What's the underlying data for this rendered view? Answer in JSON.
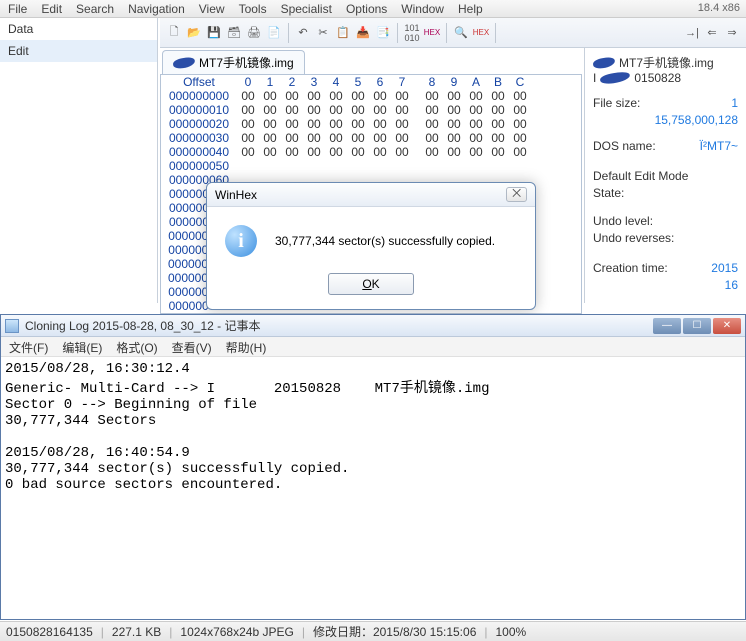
{
  "version": "18.4 x86",
  "menu": [
    "File",
    "Edit",
    "Search",
    "Navigation",
    "View",
    "Tools",
    "Specialist",
    "Options",
    "Window",
    "Help"
  ],
  "left": {
    "items": [
      "Data",
      "Edit"
    ]
  },
  "file_tab": "MT7手机镜像.img",
  "hex": {
    "offset_hdr": "Offset",
    "cols": [
      "0",
      "1",
      "2",
      "3",
      "4",
      "5",
      "6",
      "7",
      "8",
      "9",
      "A",
      "B",
      "C"
    ],
    "rows": [
      {
        "o": "000000000",
        "v": [
          "00",
          "00",
          "00",
          "00",
          "00",
          "00",
          "00",
          "00",
          "00",
          "00",
          "00",
          "00",
          "00"
        ]
      },
      {
        "o": "000000010",
        "v": [
          "00",
          "00",
          "00",
          "00",
          "00",
          "00",
          "00",
          "00",
          "00",
          "00",
          "00",
          "00",
          "00"
        ]
      },
      {
        "o": "000000020",
        "v": [
          "00",
          "00",
          "00",
          "00",
          "00",
          "00",
          "00",
          "00",
          "00",
          "00",
          "00",
          "00",
          "00"
        ]
      },
      {
        "o": "000000030",
        "v": [
          "00",
          "00",
          "00",
          "00",
          "00",
          "00",
          "00",
          "00",
          "00",
          "00",
          "00",
          "00",
          "00"
        ]
      },
      {
        "o": "000000040",
        "v": [
          "00",
          "00",
          "00",
          "00",
          "00",
          "00",
          "00",
          "00",
          "00",
          "00",
          "00",
          "00",
          "00"
        ]
      },
      {
        "o": "000000050",
        "v": [
          "",
          "",
          "",
          "",
          "",
          "",
          "",
          "",
          "",
          "",
          "",
          "",
          ""
        ]
      },
      {
        "o": "000000060",
        "v": [
          "",
          "",
          "",
          "",
          "",
          "",
          "",
          "",
          "",
          "",
          "",
          "",
          ""
        ]
      },
      {
        "o": "000000070",
        "v": [
          "",
          "",
          "",
          "",
          "",
          "",
          "",
          "",
          "",
          "",
          "",
          "",
          ""
        ]
      },
      {
        "o": "000000080",
        "v": [
          "",
          "",
          "",
          "",
          "",
          "",
          "",
          "",
          "",
          "",
          "",
          "",
          ""
        ]
      },
      {
        "o": "000000090",
        "v": [
          "",
          "",
          "",
          "",
          "",
          "",
          "",
          "",
          "",
          "",
          "",
          "",
          ""
        ]
      },
      {
        "o": "0000000A0",
        "v": [
          "",
          "",
          "",
          "",
          "",
          "",
          "",
          "",
          "",
          "",
          "",
          "",
          ""
        ]
      },
      {
        "o": "0000000B0",
        "v": [
          "",
          "",
          "",
          "",
          "",
          "",
          "",
          "",
          "",
          "",
          "",
          "",
          ""
        ]
      },
      {
        "o": "0000000C0",
        "v": [
          "",
          "",
          "",
          "",
          "",
          "",
          "",
          "",
          "",
          "",
          "",
          "",
          ""
        ]
      },
      {
        "o": "0000000D0",
        "v": [
          "",
          "",
          "",
          "",
          "",
          "",
          "",
          "",
          "",
          "",
          "",
          "",
          ""
        ]
      },
      {
        "o": "0000000E0",
        "v": [
          "",
          "",
          "",
          "",
          "",
          "",
          "",
          "",
          "",
          "",
          "",
          "",
          ""
        ]
      },
      {
        "o": "0000000F0",
        "v": [
          "",
          "",
          "",
          "",
          "",
          "",
          "",
          "",
          "",
          "",
          "",
          "",
          ""
        ]
      }
    ]
  },
  "right": {
    "file": "MT7手机镜像.img",
    "date": "0150828",
    "size_lbl": "File size:",
    "size_top": "1",
    "size": "15,758,000,128",
    "dos_lbl": "DOS name:",
    "dos": "Ï²MT7~",
    "mode_lbl": "Default Edit Mode",
    "state_lbl": "State:",
    "undo_lbl": "Undo level:",
    "undor_lbl": "Undo reverses:",
    "ctime_lbl": "Creation time:",
    "ctime1": "2015",
    "ctime2": "16"
  },
  "dlg": {
    "title": "WinHex",
    "msg": "30,777,344 sector(s) successfully copied.",
    "ok": "OK"
  },
  "notepad": {
    "title": "Cloning Log 2015-08-28, 08_30_12 - 记事本",
    "menu": [
      "文件(F)",
      "编辑(E)",
      "格式(O)",
      "查看(V)",
      "帮助(H)"
    ],
    "body": "2015/08/28, 16:30:12.4\nGeneric- Multi-Card --> I       20150828    MT7手机镜像.img\nSector 0 --> Beginning of file\n30,777,344 Sectors\n\n2015/08/28, 16:40:54.9\n30,777,344 sector(s) successfully copied.\n0 bad source sectors encountered."
  },
  "status": [
    "0150828164135",
    "227.1 KB",
    "1024x768x24b JPEG",
    "修改日期：2015/8/30 15:15:06",
    "100%"
  ]
}
